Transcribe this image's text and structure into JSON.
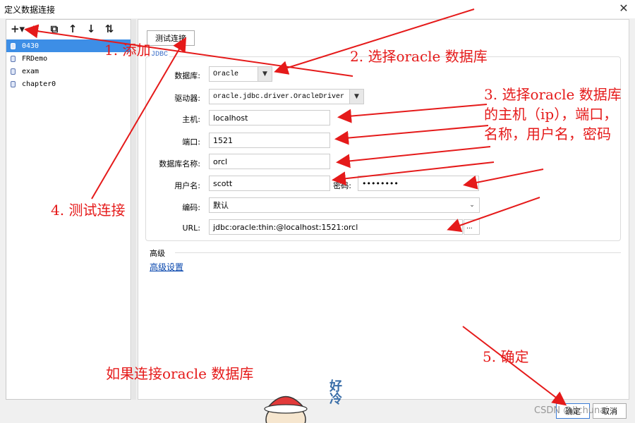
{
  "window": {
    "title": "定义数据连接",
    "close_glyph": "✕"
  },
  "toolbar": {
    "add_glyph": "+▾",
    "delete_glyph": "✕",
    "copy_glyph": "⧉",
    "up_glyph": "↑",
    "down_glyph": "↓",
    "sort_glyph": "⇅"
  },
  "connections": [
    "0430",
    "FRDemo",
    "exam",
    "chapter0"
  ],
  "test_button": "测试连接",
  "jdbc_label": "JDBC",
  "form": {
    "database_label": "数据库:",
    "database_value": "Oracle",
    "driver_label": "驱动器:",
    "driver_value": "oracle.jdbc.driver.OracleDriver",
    "host_label": "主机:",
    "host_value": "localhost",
    "port_label": "端口:",
    "port_value": "1521",
    "dbname_label": "数据库名称:",
    "dbname_value": "orcl",
    "user_label": "用户名:",
    "user_value": "scott",
    "password_label": "密码:",
    "password_value": "••••••••",
    "encoding_label": "编码:",
    "encoding_value": "默认",
    "url_label": "URL:",
    "url_value": "jdbc:oracle:thin:@localhost:1521:orcl",
    "url_more": "..."
  },
  "advanced": {
    "section_label": "高级",
    "link": "高级设置"
  },
  "footer": {
    "ok": "确定",
    "cancel": "取消"
  },
  "annotations": {
    "a1": "1. 添加",
    "a2": "2. 选择oracle 数据库",
    "a3": "3. 选择oracle 数据库的主机（ip），端口，名称，用户名，密码",
    "a4": "4. 测试连接",
    "a5": "5. 确定",
    "caption": "如果连接oracle 数据库"
  },
  "sticker_text": "好冷",
  "watermark": "CSDN @lichunai",
  "colors": {
    "annotation": "#e51a1a",
    "selection": "#3d8ee6",
    "link": "#0645ad"
  }
}
